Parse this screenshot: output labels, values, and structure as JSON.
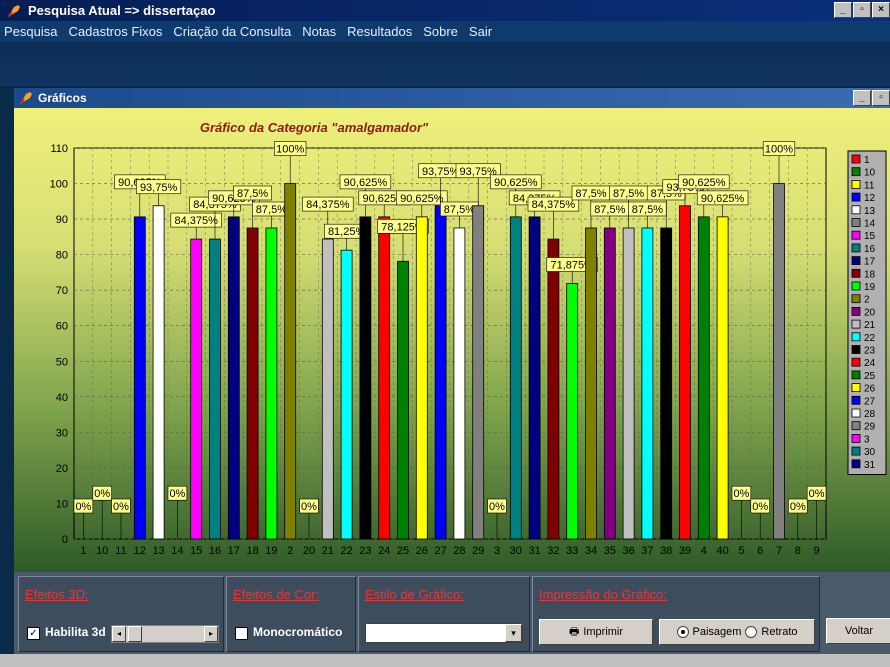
{
  "window": {
    "title": "Pesquisa Atual => dissertaçao"
  },
  "menu": [
    "Pesquisa",
    "Cadastros Fixos",
    "Criação da Consulta",
    "Notas",
    "Resultados",
    "Sobre",
    "Sair"
  ],
  "child": {
    "title": "Gráficos"
  },
  "chart_data": {
    "type": "bar",
    "title": "Gráfico da Categoria \"amalgamador\"",
    "ylim": [
      0,
      110
    ],
    "yticks": [
      0,
      10,
      20,
      30,
      40,
      50,
      60,
      70,
      80,
      90,
      100,
      110
    ],
    "categories": [
      "1",
      "10",
      "11",
      "12",
      "13",
      "14",
      "15",
      "16",
      "17",
      "18",
      "19",
      "2",
      "20",
      "21",
      "22",
      "23",
      "24",
      "25",
      "26",
      "27",
      "28",
      "29",
      "3",
      "30",
      "31",
      "32",
      "33",
      "34",
      "35",
      "36",
      "37",
      "38",
      "39",
      "4",
      "40",
      "5",
      "6",
      "7",
      "8",
      "9"
    ],
    "values": [
      0,
      0,
      0,
      90.625,
      93.75,
      0,
      84.375,
      84.375,
      90.625,
      87.5,
      87.5,
      100,
      0,
      84.375,
      81.25,
      90.625,
      90.625,
      78.125,
      90.625,
      93.75,
      87.5,
      93.75,
      0,
      90.625,
      90.625,
      84.375,
      71.875,
      87.5,
      87.5,
      87.5,
      87.5,
      87.5,
      93.75,
      90.625,
      90.625,
      0,
      0,
      100,
      0,
      0
    ],
    "labels": [
      "0%",
      "0%",
      "0%",
      "90,625%",
      "93,75%",
      "0%",
      "84,375%",
      "84,375%",
      "90,625%",
      "87,5%",
      "87,5%",
      "100%",
      "0%",
      "84,375%",
      "81,25%",
      "90,625%",
      "90,625%",
      "78,125%",
      "90,625%",
      "93,75%",
      "87,5%",
      "93,75%",
      "0%",
      "90,625%",
      "84,375%",
      "84,375%",
      "71,875%",
      "87,5%",
      "87,5%",
      "87,5%",
      "87,5%",
      "87,5%",
      "93,75%",
      "90,625%",
      "90,625%",
      "0%",
      "0%",
      "100%",
      "0%",
      "0%"
    ],
    "colors": [
      "#ff0000",
      "#008000",
      "#ffff00",
      "#0000ff",
      "#ffffff",
      "#808080",
      "#ff00ff",
      "#008080",
      "#000080",
      "#800000",
      "#00ff00",
      "#808000",
      "#800080",
      "#c0c0c0",
      "#00ffff",
      "#000000",
      "#ff0000",
      "#008000",
      "#ffff00",
      "#0000ff",
      "#ffffff",
      "#808080",
      "#ff00ff",
      "#008080",
      "#000080",
      "#800000",
      "#00ff00",
      "#808000",
      "#800080",
      "#c0c0c0",
      "#00ffff",
      "#000000",
      "#ff0000",
      "#008000",
      "#ffff00",
      "#0000ff",
      "#ffffff",
      "#808080",
      "#ff00ff",
      "#008080"
    ],
    "legend": [
      "1",
      "10",
      "11",
      "12",
      "13",
      "14",
      "15",
      "16",
      "17",
      "18",
      "19",
      "2",
      "20",
      "21",
      "22",
      "23",
      "24",
      "25",
      "26",
      "27",
      "28",
      "29",
      "3",
      "30",
      "31"
    ],
    "legend_colors": [
      "#ff0000",
      "#008000",
      "#ffff00",
      "#0000ff",
      "#ffffff",
      "#808080",
      "#ff00ff",
      "#008080",
      "#000080",
      "#800000",
      "#00ff00",
      "#808000",
      "#800080",
      "#c0c0c0",
      "#00ffff",
      "#000000",
      "#ff0000",
      "#008000",
      "#ffff00",
      "#0000ff",
      "#ffffff",
      "#808080",
      "#ff00ff",
      "#008080",
      "#000080"
    ]
  },
  "bottom": {
    "effects3d": {
      "title": "Efeitos 3D:",
      "checkbox": "Habilita 3d"
    },
    "color": {
      "title": "Efeitos de Cor:",
      "checkbox": "Monocromático"
    },
    "style": {
      "title": "Estilo de Gráfico:",
      "value": ""
    },
    "print": {
      "title": "Impressão do Gráfico:",
      "button": "Imprimir",
      "opt1": "Paisagem",
      "opt2": "Retrato"
    },
    "back": "Voltar"
  }
}
